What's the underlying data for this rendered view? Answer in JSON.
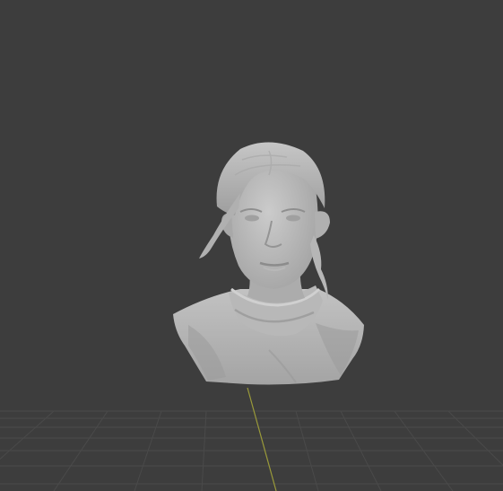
{
  "viewport": {
    "background_color": "#3d3d3d",
    "grid_color": "#4a4a4a",
    "y_axis_color": "#9a9a3a",
    "model_color": "#b4b4b4",
    "model_shadow_color": "#8a8a8a",
    "model_highlight_color": "#cdcdcd"
  },
  "model": {
    "icon": "sculpted-bust"
  }
}
